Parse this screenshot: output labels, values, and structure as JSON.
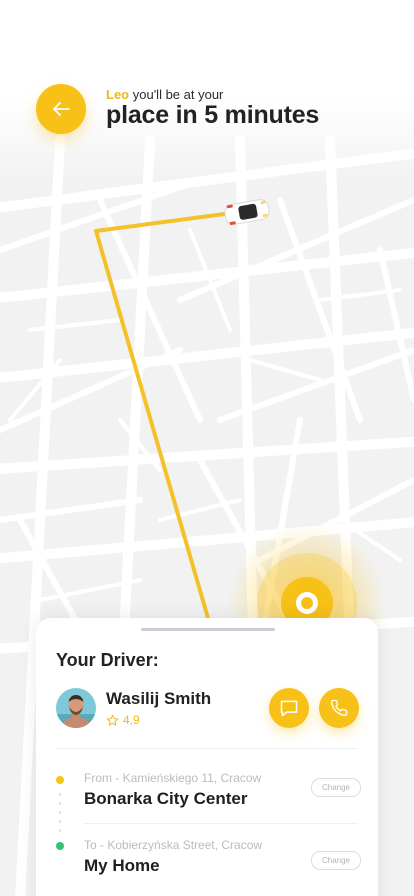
{
  "header": {
    "user_name": "Leo",
    "line1_rest": " you'll be at your",
    "line2": "place in 5 minutes"
  },
  "colors": {
    "accent": "#f7c117",
    "route": "#f5c12a",
    "destination_dot": "#38c172"
  },
  "icons": {
    "back": "arrow-left-icon",
    "car": "car-icon",
    "chat": "chat-icon",
    "call": "phone-icon",
    "star": "star-icon"
  },
  "driver_card": {
    "title": "Your Driver:",
    "driver_name": "Wasilij Smith",
    "rating": "4,9"
  },
  "route": {
    "from_label": "From - Kamieńskiego 11, Cracow",
    "from_value": "Bonarka City Center",
    "to_label": "To - Kobierzyńska Street, Cracow",
    "to_value": "My Home",
    "change_label": "Change"
  }
}
